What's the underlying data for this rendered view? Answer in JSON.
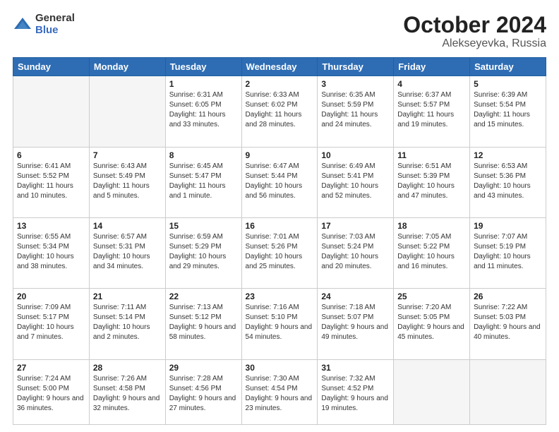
{
  "header": {
    "logo_general": "General",
    "logo_blue": "Blue",
    "month": "October 2024",
    "location": "Alekseyevka, Russia"
  },
  "days_of_week": [
    "Sunday",
    "Monday",
    "Tuesday",
    "Wednesday",
    "Thursday",
    "Friday",
    "Saturday"
  ],
  "weeks": [
    [
      {
        "day": "",
        "info": ""
      },
      {
        "day": "",
        "info": ""
      },
      {
        "day": "1",
        "info": "Sunrise: 6:31 AM\nSunset: 6:05 PM\nDaylight: 11 hours\nand 33 minutes."
      },
      {
        "day": "2",
        "info": "Sunrise: 6:33 AM\nSunset: 6:02 PM\nDaylight: 11 hours\nand 28 minutes."
      },
      {
        "day": "3",
        "info": "Sunrise: 6:35 AM\nSunset: 5:59 PM\nDaylight: 11 hours\nand 24 minutes."
      },
      {
        "day": "4",
        "info": "Sunrise: 6:37 AM\nSunset: 5:57 PM\nDaylight: 11 hours\nand 19 minutes."
      },
      {
        "day": "5",
        "info": "Sunrise: 6:39 AM\nSunset: 5:54 PM\nDaylight: 11 hours\nand 15 minutes."
      }
    ],
    [
      {
        "day": "6",
        "info": "Sunrise: 6:41 AM\nSunset: 5:52 PM\nDaylight: 11 hours\nand 10 minutes."
      },
      {
        "day": "7",
        "info": "Sunrise: 6:43 AM\nSunset: 5:49 PM\nDaylight: 11 hours\nand 5 minutes."
      },
      {
        "day": "8",
        "info": "Sunrise: 6:45 AM\nSunset: 5:47 PM\nDaylight: 11 hours\nand 1 minute."
      },
      {
        "day": "9",
        "info": "Sunrise: 6:47 AM\nSunset: 5:44 PM\nDaylight: 10 hours\nand 56 minutes."
      },
      {
        "day": "10",
        "info": "Sunrise: 6:49 AM\nSunset: 5:41 PM\nDaylight: 10 hours\nand 52 minutes."
      },
      {
        "day": "11",
        "info": "Sunrise: 6:51 AM\nSunset: 5:39 PM\nDaylight: 10 hours\nand 47 minutes."
      },
      {
        "day": "12",
        "info": "Sunrise: 6:53 AM\nSunset: 5:36 PM\nDaylight: 10 hours\nand 43 minutes."
      }
    ],
    [
      {
        "day": "13",
        "info": "Sunrise: 6:55 AM\nSunset: 5:34 PM\nDaylight: 10 hours\nand 38 minutes."
      },
      {
        "day": "14",
        "info": "Sunrise: 6:57 AM\nSunset: 5:31 PM\nDaylight: 10 hours\nand 34 minutes."
      },
      {
        "day": "15",
        "info": "Sunrise: 6:59 AM\nSunset: 5:29 PM\nDaylight: 10 hours\nand 29 minutes."
      },
      {
        "day": "16",
        "info": "Sunrise: 7:01 AM\nSunset: 5:26 PM\nDaylight: 10 hours\nand 25 minutes."
      },
      {
        "day": "17",
        "info": "Sunrise: 7:03 AM\nSunset: 5:24 PM\nDaylight: 10 hours\nand 20 minutes."
      },
      {
        "day": "18",
        "info": "Sunrise: 7:05 AM\nSunset: 5:22 PM\nDaylight: 10 hours\nand 16 minutes."
      },
      {
        "day": "19",
        "info": "Sunrise: 7:07 AM\nSunset: 5:19 PM\nDaylight: 10 hours\nand 11 minutes."
      }
    ],
    [
      {
        "day": "20",
        "info": "Sunrise: 7:09 AM\nSunset: 5:17 PM\nDaylight: 10 hours\nand 7 minutes."
      },
      {
        "day": "21",
        "info": "Sunrise: 7:11 AM\nSunset: 5:14 PM\nDaylight: 10 hours\nand 2 minutes."
      },
      {
        "day": "22",
        "info": "Sunrise: 7:13 AM\nSunset: 5:12 PM\nDaylight: 9 hours\nand 58 minutes."
      },
      {
        "day": "23",
        "info": "Sunrise: 7:16 AM\nSunset: 5:10 PM\nDaylight: 9 hours\nand 54 minutes."
      },
      {
        "day": "24",
        "info": "Sunrise: 7:18 AM\nSunset: 5:07 PM\nDaylight: 9 hours\nand 49 minutes."
      },
      {
        "day": "25",
        "info": "Sunrise: 7:20 AM\nSunset: 5:05 PM\nDaylight: 9 hours\nand 45 minutes."
      },
      {
        "day": "26",
        "info": "Sunrise: 7:22 AM\nSunset: 5:03 PM\nDaylight: 9 hours\nand 40 minutes."
      }
    ],
    [
      {
        "day": "27",
        "info": "Sunrise: 7:24 AM\nSunset: 5:00 PM\nDaylight: 9 hours\nand 36 minutes."
      },
      {
        "day": "28",
        "info": "Sunrise: 7:26 AM\nSunset: 4:58 PM\nDaylight: 9 hours\nand 32 minutes."
      },
      {
        "day": "29",
        "info": "Sunrise: 7:28 AM\nSunset: 4:56 PM\nDaylight: 9 hours\nand 27 minutes."
      },
      {
        "day": "30",
        "info": "Sunrise: 7:30 AM\nSunset: 4:54 PM\nDaylight: 9 hours\nand 23 minutes."
      },
      {
        "day": "31",
        "info": "Sunrise: 7:32 AM\nSunset: 4:52 PM\nDaylight: 9 hours\nand 19 minutes."
      },
      {
        "day": "",
        "info": ""
      },
      {
        "day": "",
        "info": ""
      }
    ]
  ]
}
